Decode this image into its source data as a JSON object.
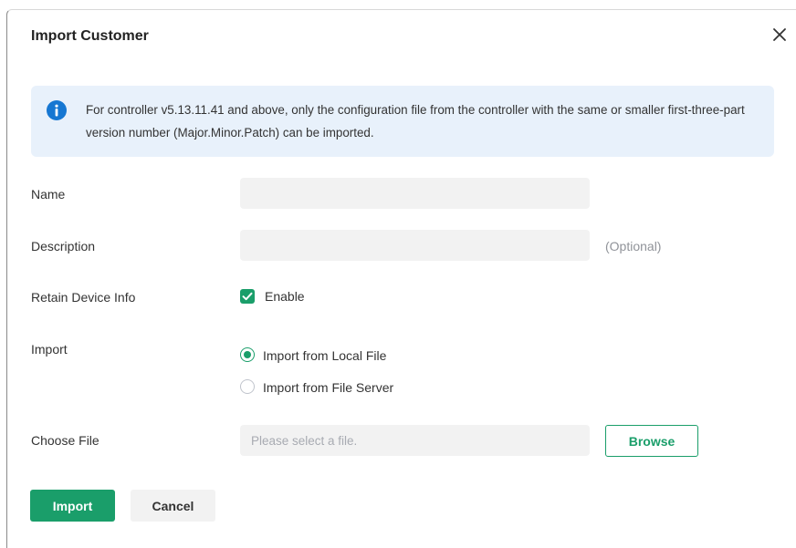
{
  "dialog": {
    "title": "Import Customer",
    "close_icon": "close-icon"
  },
  "notice": {
    "icon": "info-icon",
    "text": "For controller v5.13.11.41 and above, only the configuration file from the controller with the same or smaller first-three-part version number (Major.Minor.Patch) can be imported."
  },
  "form": {
    "name": {
      "label": "Name",
      "value": "",
      "placeholder": ""
    },
    "description": {
      "label": "Description",
      "value": "",
      "placeholder": "",
      "hint": "(Optional)"
    },
    "retain_device_info": {
      "label": "Retain Device Info",
      "option_label": "Enable",
      "checked": true
    },
    "import": {
      "label": "Import",
      "options": [
        {
          "label": "Import from Local File",
          "selected": true
        },
        {
          "label": "Import from File Server",
          "selected": false
        }
      ]
    },
    "choose_file": {
      "label": "Choose File",
      "placeholder": "Please select a file.",
      "browse_label": "Browse"
    }
  },
  "footer": {
    "import_label": "Import",
    "cancel_label": "Cancel"
  },
  "colors": {
    "accent": "#1a9e6a",
    "notice_bg": "#e8f1fb",
    "info_icon": "#1677d2",
    "input_bg": "#f2f2f2"
  }
}
